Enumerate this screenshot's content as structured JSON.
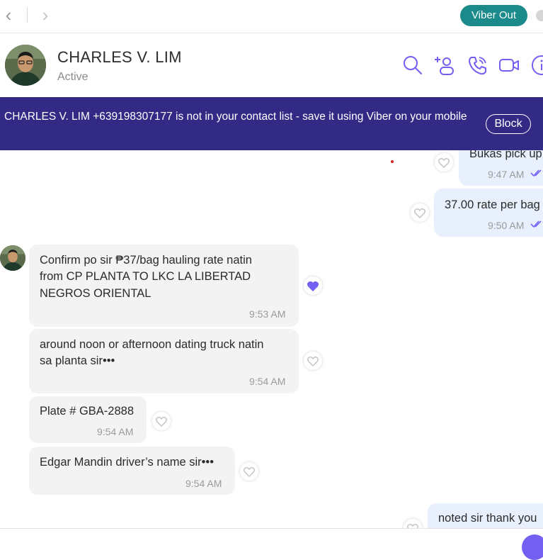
{
  "nav": {
    "back_glyph": "‹",
    "forward_glyph": "›",
    "viber_out_label": "Viber Out"
  },
  "contact": {
    "name": "CHARLES V. LIM",
    "status": "Active"
  },
  "header_icons": [
    "search-icon",
    "add-participant-icon",
    "voice-call-icon",
    "video-call-icon",
    "info-icon"
  ],
  "banner": {
    "text": "CHARLES V. LIM +639198307177 is not in your contact list - save it using Viber on your mobile",
    "block_label": "Block"
  },
  "messages": [
    {
      "direction": "outgoing",
      "lines": [
        "Bukas pick up"
      ],
      "time": "9:47 AM",
      "status": "seen"
    },
    {
      "direction": "outgoing",
      "lines": [
        "37.00 rate per bag"
      ],
      "time": "9:50 AM",
      "status": "seen"
    },
    {
      "direction": "incoming",
      "lines": [
        "Confirm po sir ₱37/bag hauling rate natin",
        "from CP PLANTA TO LKC LA LIBERTAD",
        "NEGROS ORIENTAL"
      ],
      "time": "9:53 AM",
      "liked": true
    },
    {
      "direction": "incoming",
      "lines": [
        "around noon or afternoon dating truck natin",
        "sa planta sir•••"
      ],
      "time": "9:54 AM",
      "liked": false
    },
    {
      "direction": "incoming",
      "lines": [
        "Plate # GBA-2888"
      ],
      "time": "9:54 AM",
      "liked": false
    },
    {
      "direction": "incoming",
      "lines": [
        "Edgar Mandin driver’s name sir•••"
      ],
      "time": "9:54 AM",
      "liked": false
    },
    {
      "direction": "outgoing",
      "lines": [
        "noted sir thank you"
      ],
      "time": "",
      "status": ""
    }
  ],
  "colors": {
    "accent": "#7360f2",
    "banner": "#332a86",
    "viber_out": "#1b8a8a",
    "incoming_bubble": "#f3f3f3",
    "outgoing_bubble": "#e9f0fd"
  }
}
